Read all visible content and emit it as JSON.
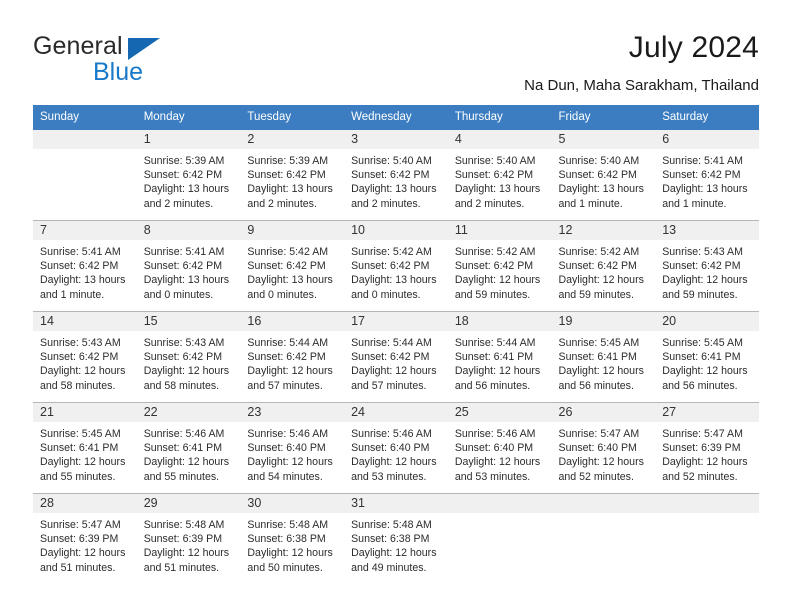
{
  "brand": {
    "name_part1": "General",
    "name_part2": "Blue",
    "triangle_color": "#1667b2",
    "blue_color": "#1879c9"
  },
  "header": {
    "title": "July 2024",
    "subtitle": "Na Dun, Maha Sarakham, Thailand",
    "header_bg_color": "#3b7dc0",
    "daynum_band_color": "#f0f0f0"
  },
  "calendar": {
    "weekday_headers": [
      "Sunday",
      "Monday",
      "Tuesday",
      "Wednesday",
      "Thursday",
      "Friday",
      "Saturday"
    ],
    "weeks": [
      [
        {
          "day": "",
          "lines": []
        },
        {
          "day": "1",
          "lines": [
            "Sunrise: 5:39 AM",
            "Sunset: 6:42 PM",
            "Daylight: 13 hours",
            "and 2 minutes."
          ]
        },
        {
          "day": "2",
          "lines": [
            "Sunrise: 5:39 AM",
            "Sunset: 6:42 PM",
            "Daylight: 13 hours",
            "and 2 minutes."
          ]
        },
        {
          "day": "3",
          "lines": [
            "Sunrise: 5:40 AM",
            "Sunset: 6:42 PM",
            "Daylight: 13 hours",
            "and 2 minutes."
          ]
        },
        {
          "day": "4",
          "lines": [
            "Sunrise: 5:40 AM",
            "Sunset: 6:42 PM",
            "Daylight: 13 hours",
            "and 2 minutes."
          ]
        },
        {
          "day": "5",
          "lines": [
            "Sunrise: 5:40 AM",
            "Sunset: 6:42 PM",
            "Daylight: 13 hours",
            "and 1 minute."
          ]
        },
        {
          "day": "6",
          "lines": [
            "Sunrise: 5:41 AM",
            "Sunset: 6:42 PM",
            "Daylight: 13 hours",
            "and 1 minute."
          ]
        }
      ],
      [
        {
          "day": "7",
          "lines": [
            "Sunrise: 5:41 AM",
            "Sunset: 6:42 PM",
            "Daylight: 13 hours",
            "and 1 minute."
          ]
        },
        {
          "day": "8",
          "lines": [
            "Sunrise: 5:41 AM",
            "Sunset: 6:42 PM",
            "Daylight: 13 hours",
            "and 0 minutes."
          ]
        },
        {
          "day": "9",
          "lines": [
            "Sunrise: 5:42 AM",
            "Sunset: 6:42 PM",
            "Daylight: 13 hours",
            "and 0 minutes."
          ]
        },
        {
          "day": "10",
          "lines": [
            "Sunrise: 5:42 AM",
            "Sunset: 6:42 PM",
            "Daylight: 13 hours",
            "and 0 minutes."
          ]
        },
        {
          "day": "11",
          "lines": [
            "Sunrise: 5:42 AM",
            "Sunset: 6:42 PM",
            "Daylight: 12 hours",
            "and 59 minutes."
          ]
        },
        {
          "day": "12",
          "lines": [
            "Sunrise: 5:42 AM",
            "Sunset: 6:42 PM",
            "Daylight: 12 hours",
            "and 59 minutes."
          ]
        },
        {
          "day": "13",
          "lines": [
            "Sunrise: 5:43 AM",
            "Sunset: 6:42 PM",
            "Daylight: 12 hours",
            "and 59 minutes."
          ]
        }
      ],
      [
        {
          "day": "14",
          "lines": [
            "Sunrise: 5:43 AM",
            "Sunset: 6:42 PM",
            "Daylight: 12 hours",
            "and 58 minutes."
          ]
        },
        {
          "day": "15",
          "lines": [
            "Sunrise: 5:43 AM",
            "Sunset: 6:42 PM",
            "Daylight: 12 hours",
            "and 58 minutes."
          ]
        },
        {
          "day": "16",
          "lines": [
            "Sunrise: 5:44 AM",
            "Sunset: 6:42 PM",
            "Daylight: 12 hours",
            "and 57 minutes."
          ]
        },
        {
          "day": "17",
          "lines": [
            "Sunrise: 5:44 AM",
            "Sunset: 6:42 PM",
            "Daylight: 12 hours",
            "and 57 minutes."
          ]
        },
        {
          "day": "18",
          "lines": [
            "Sunrise: 5:44 AM",
            "Sunset: 6:41 PM",
            "Daylight: 12 hours",
            "and 56 minutes."
          ]
        },
        {
          "day": "19",
          "lines": [
            "Sunrise: 5:45 AM",
            "Sunset: 6:41 PM",
            "Daylight: 12 hours",
            "and 56 minutes."
          ]
        },
        {
          "day": "20",
          "lines": [
            "Sunrise: 5:45 AM",
            "Sunset: 6:41 PM",
            "Daylight: 12 hours",
            "and 56 minutes."
          ]
        }
      ],
      [
        {
          "day": "21",
          "lines": [
            "Sunrise: 5:45 AM",
            "Sunset: 6:41 PM",
            "Daylight: 12 hours",
            "and 55 minutes."
          ]
        },
        {
          "day": "22",
          "lines": [
            "Sunrise: 5:46 AM",
            "Sunset: 6:41 PM",
            "Daylight: 12 hours",
            "and 55 minutes."
          ]
        },
        {
          "day": "23",
          "lines": [
            "Sunrise: 5:46 AM",
            "Sunset: 6:40 PM",
            "Daylight: 12 hours",
            "and 54 minutes."
          ]
        },
        {
          "day": "24",
          "lines": [
            "Sunrise: 5:46 AM",
            "Sunset: 6:40 PM",
            "Daylight: 12 hours",
            "and 53 minutes."
          ]
        },
        {
          "day": "25",
          "lines": [
            "Sunrise: 5:46 AM",
            "Sunset: 6:40 PM",
            "Daylight: 12 hours",
            "and 53 minutes."
          ]
        },
        {
          "day": "26",
          "lines": [
            "Sunrise: 5:47 AM",
            "Sunset: 6:40 PM",
            "Daylight: 12 hours",
            "and 52 minutes."
          ]
        },
        {
          "day": "27",
          "lines": [
            "Sunrise: 5:47 AM",
            "Sunset: 6:39 PM",
            "Daylight: 12 hours",
            "and 52 minutes."
          ]
        }
      ],
      [
        {
          "day": "28",
          "lines": [
            "Sunrise: 5:47 AM",
            "Sunset: 6:39 PM",
            "Daylight: 12 hours",
            "and 51 minutes."
          ]
        },
        {
          "day": "29",
          "lines": [
            "Sunrise: 5:48 AM",
            "Sunset: 6:39 PM",
            "Daylight: 12 hours",
            "and 51 minutes."
          ]
        },
        {
          "day": "30",
          "lines": [
            "Sunrise: 5:48 AM",
            "Sunset: 6:38 PM",
            "Daylight: 12 hours",
            "and 50 minutes."
          ]
        },
        {
          "day": "31",
          "lines": [
            "Sunrise: 5:48 AM",
            "Sunset: 6:38 PM",
            "Daylight: 12 hours",
            "and 49 minutes."
          ]
        },
        {
          "day": "",
          "lines": []
        },
        {
          "day": "",
          "lines": []
        },
        {
          "day": "",
          "lines": []
        }
      ]
    ]
  }
}
